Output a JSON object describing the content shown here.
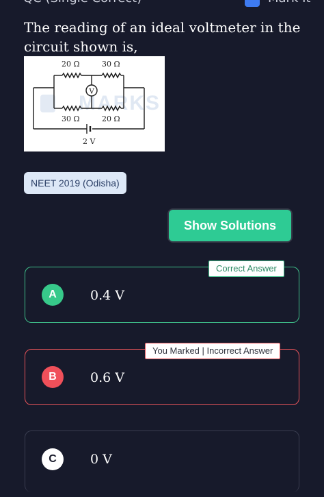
{
  "header": {
    "left_text": "QC (Single Correct)",
    "right_text": "Mark It"
  },
  "question": {
    "text": "The reading of an ideal voltmeter in the circuit shown is,"
  },
  "figure": {
    "labels": {
      "r_top_left": "20 Ω",
      "r_top_right": "30 Ω",
      "r_bottom_left": "30 Ω",
      "r_bottom_right": "20 Ω",
      "voltmeter": "V",
      "battery": "2 V"
    },
    "watermark": "MARKS"
  },
  "tag": {
    "label": "NEET 2019 (Odisha)"
  },
  "show_solutions": {
    "label": "Show Solutions"
  },
  "options": [
    {
      "letter": "A",
      "value": "0.4 V",
      "badge": "Correct Answer",
      "status": "correct"
    },
    {
      "letter": "B",
      "value": "0.6 V",
      "badge": "You Marked | Incorrect Answer",
      "status": "incorrect"
    },
    {
      "letter": "C",
      "value": "0 V",
      "status": "neutral"
    }
  ],
  "colors": {
    "background": "#171a2b",
    "correct": "#37c98a",
    "incorrect": "#f0505a",
    "button": "#2ecb94",
    "tag_bg": "#dde8f7"
  }
}
